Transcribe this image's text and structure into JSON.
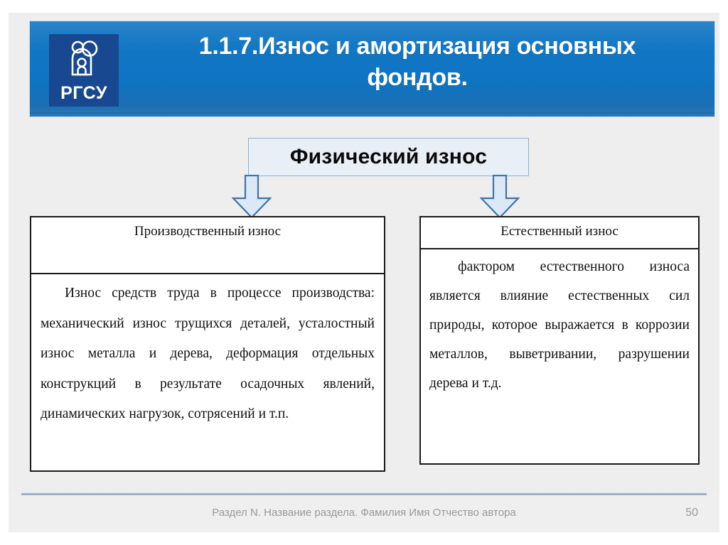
{
  "slide": {
    "header": {
      "title": "1.1.7.Износ и амортизация основных\nфондов.",
      "logo": {
        "text": "РГСУ",
        "icon": "family-people-icon"
      }
    },
    "center_box": {
      "label": "Физический износ"
    },
    "arrows": [
      {
        "name": "arrow-down-to-left-table"
      },
      {
        "name": "arrow-down-to-right-table"
      }
    ],
    "tables": [
      {
        "name": "production-wear-table",
        "header": "Производственный износ",
        "body": "Износ средств труда в процессе производства: механический износ трущихся деталей, усталостный износ металла и дерева, деформация отдельных конструкций в результате осадочных явлений, динамических нагрузок, сотрясений и т.п."
      },
      {
        "name": "natural-wear-table",
        "header": "Естественный износ",
        "body": "фактором естественного износа является влияние естественных сил природы, которое выражается в коррозии металлов, выветривании, разрушении дерева и т.д."
      }
    ],
    "footer": {
      "text": "Раздел N. Название раздела. Фамилия Имя Отчество автора",
      "page": "50"
    },
    "colors": {
      "header_band_blue": "#0e74c3",
      "logo_navy": "#18488f",
      "center_box_fill": "#e9eff7",
      "center_box_border": "#8ab0d4",
      "arrow_fill": "#dbe8f6",
      "arrow_stroke": "#3f74ab",
      "table_border": "#1a1a1a",
      "slide_background": "#eeeeee",
      "footer_text": "#9a9a9a"
    }
  }
}
